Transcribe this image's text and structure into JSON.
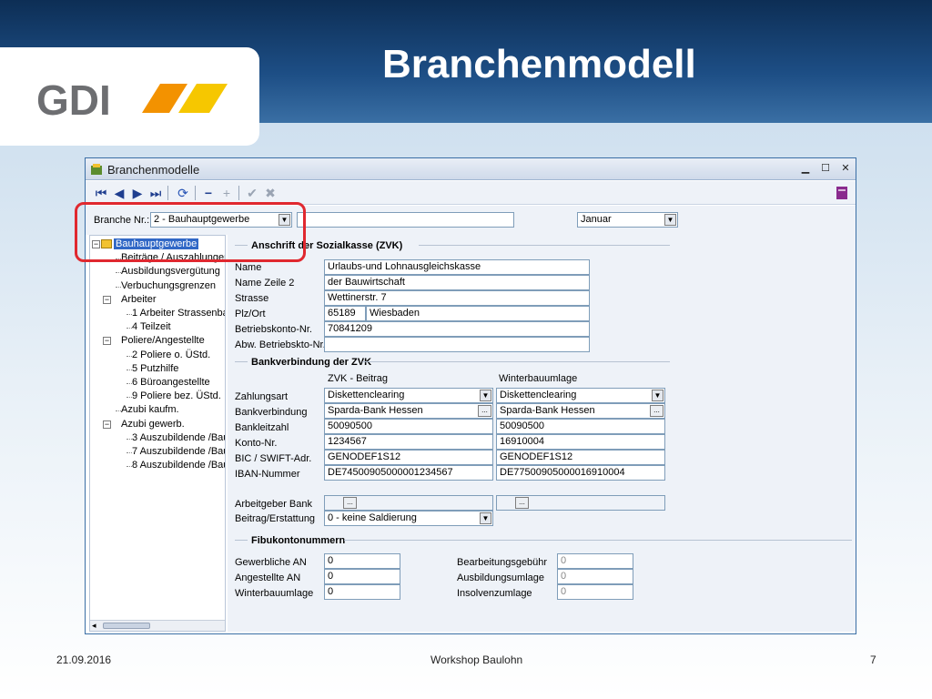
{
  "slide": {
    "title": "Branchenmodell",
    "date": "21.09.2016",
    "footer_center": "Workshop Baulohn",
    "page_number": "7",
    "logo_text": "GDI",
    "colors": {
      "header_blue": "#1d4e85",
      "logo_grey": "#6d6e71",
      "logo_orange": "#f39200",
      "logo_yellow": "#f6c700",
      "highlight_red": "#e0282f"
    }
  },
  "window": {
    "title": "Branchenmodelle",
    "toolbar": [
      "first-icon",
      "prev-icon",
      "next-icon",
      "last-icon",
      "refresh-icon",
      "minus-icon",
      "plus-icon",
      "check-icon",
      "cancel-icon",
      "book-icon"
    ]
  },
  "top_form": {
    "branche_label": "Branche Nr.:",
    "branche_value": "2 - Bauhauptgewerbe",
    "text_value": "",
    "month_value": "Januar"
  },
  "tree": [
    {
      "label": "Bauhauptgewerbe",
      "level": 0,
      "toggle": "−",
      "selected": true
    },
    {
      "label": "Beiträge / Auszahlungen",
      "level": 1
    },
    {
      "label": "Ausbildungsvergütung",
      "level": 1
    },
    {
      "label": "Verbuchungsgrenzen",
      "level": 1
    },
    {
      "label": "Arbeiter",
      "level": 1,
      "toggle": "−"
    },
    {
      "label": "1 Arbeiter Strassenba",
      "level": 2
    },
    {
      "label": "4 Teilzeit",
      "level": 2
    },
    {
      "label": "Poliere/Angestellte",
      "level": 1,
      "toggle": "−"
    },
    {
      "label": "2 Poliere o. ÜStd.",
      "level": 2
    },
    {
      "label": "5 Putzhilfe",
      "level": 2
    },
    {
      "label": "6 Büroangestellte",
      "level": 2
    },
    {
      "label": "9 Poliere bez. ÜStd.",
      "level": 2
    },
    {
      "label": "Azubi kaufm.",
      "level": 1
    },
    {
      "label": "Azubi gewerb.",
      "level": 1,
      "toggle": "−"
    },
    {
      "label": "3 Auszubildende /Bau",
      "level": 2
    },
    {
      "label": "7 Auszubildende /Bau",
      "level": 2
    },
    {
      "label": "8 Auszubildende /Bau",
      "level": 2
    }
  ],
  "zvk": {
    "section_title": "Anschrift der Sozialkasse (ZVK)",
    "name_label": "Name",
    "name_value": "Urlaubs-und Lohnausgleichskasse",
    "name2_label": "Name  Zeile 2",
    "name2_value": "der Bauwirtschaft",
    "street_label": "Strasse",
    "street_value": "Wettinerstr. 7",
    "plz_label": "Plz/Ort",
    "plz_value": "65189",
    "ort_value": "Wiesbaden",
    "konto_label": "Betriebskonto-Nr.",
    "konto_value": "70841209",
    "abw_label": "Abw. Betriebskto-Nr.",
    "abw_value": ""
  },
  "bank": {
    "section_title": "Bankverbindung der ZVK",
    "col1_header": "ZVK - Beitrag",
    "col2_header": "Winterbauumlage",
    "zahlungsart_label": "Zahlungsart",
    "zahlungsart_1": "Diskettenclearing",
    "zahlungsart_2": "Diskettenclearing",
    "bankverbindung_label": "Bankverbindung",
    "bank_1": "Sparda-Bank Hessen",
    "bank_2": "Sparda-Bank Hessen",
    "blz_label": "Bankleitzahl",
    "blz_1": "50090500",
    "blz_2": "50090500",
    "konto_label": "Konto-Nr.",
    "konto_1": "1234567",
    "konto_2": "16910004",
    "bic_label": "BIC / SWIFT-Adr.",
    "bic_1": "GENODEF1S12",
    "bic_2": "GENODEF1S12",
    "iban_label": "IBAN-Nummer",
    "iban_1": "DE74500905000001234567",
    "iban_2": "DE77500905000016910004",
    "arbeitgeber_label": "Arbeitgeber Bank",
    "arbeitgeber_1": "",
    "arbeitgeber_2": "",
    "beitrag_label": "Beitrag/Erstattung",
    "beitrag_value": "0 - keine Saldierung"
  },
  "fibu": {
    "section_title": "Fibukontonummern",
    "gewerbliche_label": "Gewerbliche AN",
    "gewerbliche_value": "0",
    "angestellte_label": "Angestellte AN",
    "angestellte_value": "0",
    "winterbau_label": "Winterbauumlage",
    "winterbau_value": "0",
    "bearbeitung_label": "Bearbeitungsgebühr",
    "bearbeitung_value": "0",
    "ausbildung_label": "Ausbildungsumlage",
    "ausbildung_value": "0",
    "insolvenz_label": "Insolvenzumlage",
    "insolvenz_value": "0"
  }
}
